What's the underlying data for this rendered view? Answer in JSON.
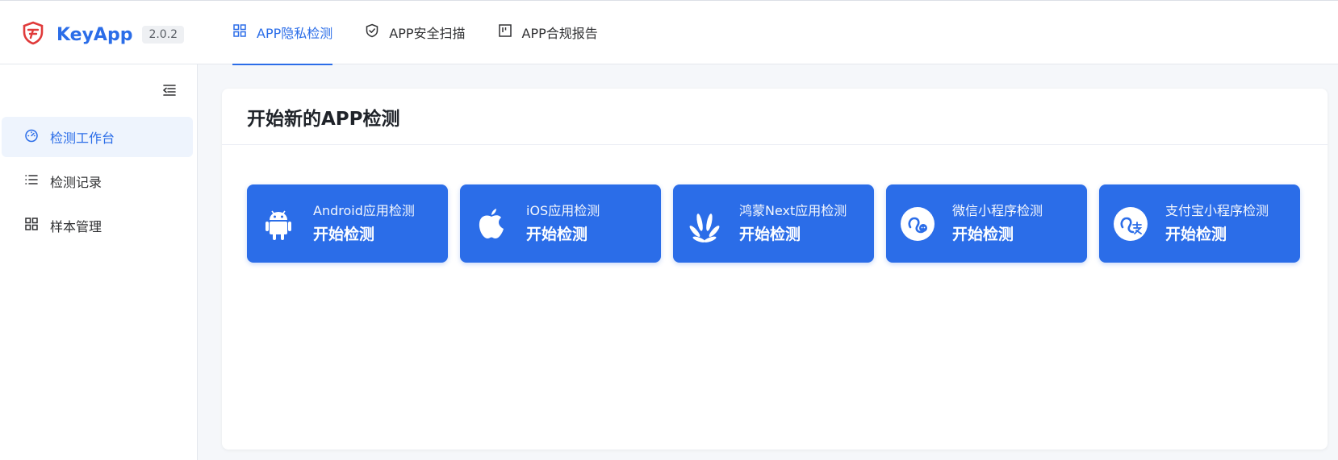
{
  "header": {
    "brand_name": "KeyApp",
    "version": "2.0.2",
    "tabs": [
      {
        "label": "APP隐私检测",
        "icon": "grid-icon",
        "active": true
      },
      {
        "label": "APP安全扫描",
        "icon": "shield-check-icon",
        "active": false
      },
      {
        "label": "APP合规报告",
        "icon": "kanban-icon",
        "active": false
      }
    ]
  },
  "sidebar": {
    "collapse_icon": "menu-fold-icon",
    "items": [
      {
        "label": "检测工作台",
        "icon": "dashboard-icon",
        "active": true
      },
      {
        "label": "检测记录",
        "icon": "list-icon",
        "active": false
      },
      {
        "label": "样本管理",
        "icon": "grid-icon",
        "active": false
      }
    ]
  },
  "main": {
    "card_title": "开始新的APP检测",
    "tiles": [
      {
        "title": "Android应用检测",
        "action": "开始检测",
        "icon": "android-icon"
      },
      {
        "title": "iOS应用检测",
        "action": "开始检测",
        "icon": "apple-icon"
      },
      {
        "title": "鸿蒙Next应用检测",
        "action": "开始检测",
        "icon": "huawei-icon"
      },
      {
        "title": "微信小程序检测",
        "action": "开始检测",
        "icon": "wechat-miniprogram-icon"
      },
      {
        "title": "支付宝小程序检测",
        "action": "开始检测",
        "icon": "alipay-miniprogram-icon"
      }
    ]
  },
  "colors": {
    "primary": "#2b6de8",
    "brand_logo": "#e03a3a",
    "active_menu_bg": "#eef4fd",
    "page_bg": "#f5f7fa"
  }
}
